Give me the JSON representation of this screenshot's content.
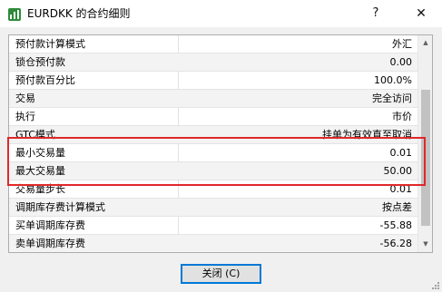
{
  "window": {
    "title": "EURDKK 的合约细则",
    "help_label": "?",
    "close_label": "✕",
    "icon": "app-chart-icon"
  },
  "spec_rows": [
    {
      "label": "预付款计算模式",
      "value": "外汇"
    },
    {
      "label": "锁仓预付款",
      "value": "0.00"
    },
    {
      "label": "预付款百分比",
      "value": "100.0%"
    },
    {
      "label": "交易",
      "value": "完全访问"
    },
    {
      "label": "执行",
      "value": "市价"
    },
    {
      "label": "GTC模式",
      "value": "挂单为有效直至取消"
    },
    {
      "label": "最小交易量",
      "value": "0.01"
    },
    {
      "label": "最大交易量",
      "value": "50.00"
    },
    {
      "label": "交易量步长",
      "value": "0.01"
    },
    {
      "label": "调期库存费计算模式",
      "value": "按点差"
    },
    {
      "label": "买单调期库存费",
      "value": "-55.88"
    },
    {
      "label": "卖单调期库存费",
      "value": "-56.28"
    }
  ],
  "footer": {
    "close_button_label": "关闭 (C)"
  },
  "colors": {
    "highlight_border": "#e0282a",
    "button_border": "#0078d7"
  }
}
